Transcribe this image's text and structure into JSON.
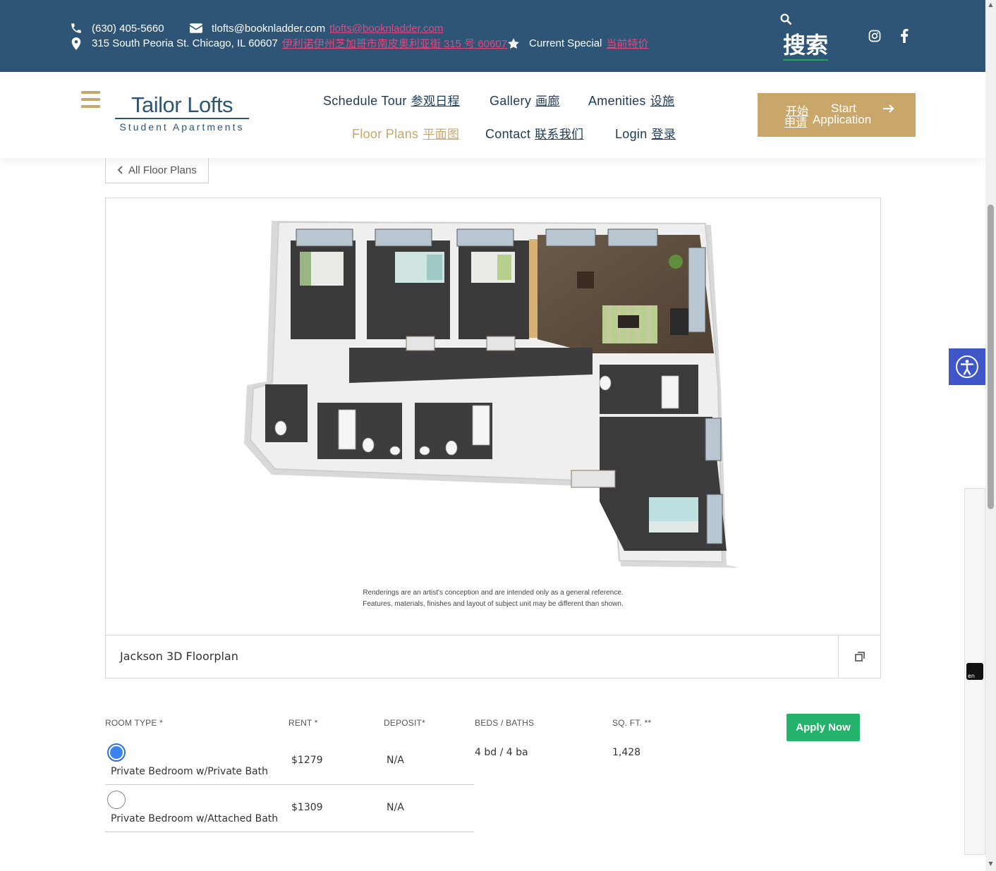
{
  "topbar": {
    "phone": "(630) 405-5660",
    "email": "tlofts@booknladder.com",
    "email_translated": "tlofts@booknladder.com",
    "address": "315 South Peoria St. Chicago, IL 60607",
    "address_translated": "伊利诺伊州芝加哥市南皮奥利亚街 315 号 60607",
    "special": "Current Special",
    "special_translated": "当前特价",
    "search_label": "搜索",
    "icons": [
      "phone-icon",
      "envelope-icon",
      "map-pin-icon",
      "star-icon",
      "search-icon",
      "instagram-icon",
      "facebook-icon"
    ]
  },
  "brand": {
    "name": "Tailor Lofts",
    "tagline": "Student Apartments",
    "primary_color": "#2e5575",
    "accent_color": "#c9a76a"
  },
  "nav": {
    "items": [
      {
        "label": "Schedule Tour",
        "translated": "参观日程"
      },
      {
        "label": "Gallery",
        "translated": "画廊"
      },
      {
        "label": "Amenities",
        "translated": "设施"
      },
      {
        "label": "Floor Plans",
        "translated": "平面图",
        "active": true
      },
      {
        "label": "Contact",
        "translated": "联系我们"
      },
      {
        "label": "Login",
        "translated": "登录"
      }
    ],
    "cta": {
      "label_line1": "Start",
      "label_line2": "Application",
      "translated_line1": "开始",
      "translated_line2": "申请"
    }
  },
  "back_button": {
    "label": "All Floor Plans"
  },
  "floorplan": {
    "caption": "Jackson 3D Floorplan",
    "disclaimer_line1": "Renderings are an artist's conception and are intended only as a general reference.",
    "disclaimer_line2": "Features, materials, finishes and layout of subject unit may be different than shown."
  },
  "table": {
    "headers": {
      "room_type": "ROOM TYPE *",
      "rent": "RENT *",
      "deposit": "DEPOSIT*",
      "beds_baths": "BEDS / BATHS",
      "sqft": "SQ. FT. **"
    },
    "rows": [
      {
        "room_type": "Private Bedroom w/Private Bath",
        "rent": "$1279",
        "deposit": "N/A",
        "selected": true
      },
      {
        "room_type": "Private Bedroom w/Attached Bath",
        "rent": "$1309",
        "deposit": "N/A",
        "selected": false
      }
    ],
    "beds_baths": "4 bd / 4 ba",
    "sqft": "1,428",
    "apply_label": "Apply Now",
    "apply_color": "#23b36a"
  },
  "widgets": {
    "translate_label": "en"
  }
}
